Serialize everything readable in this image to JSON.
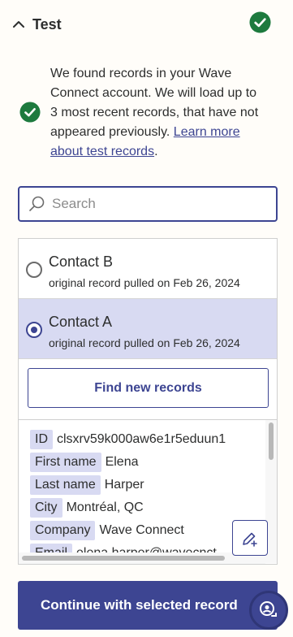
{
  "section": {
    "title": "Test",
    "status_icon": "check-circle-icon",
    "status_color": "#1d7a3e"
  },
  "info": {
    "text": "We found records in your Wave Connect account. We will load up to 3 most recent records, that have not appeared previously. ",
    "link_text": "Learn more about test records",
    "trailing": "."
  },
  "search": {
    "value": "",
    "placeholder": "Search"
  },
  "records": [
    {
      "title": "Contact B",
      "subtitle": "original record pulled on Feb 26, 2024",
      "selected": false
    },
    {
      "title": "Contact A",
      "subtitle": "original record pulled on Feb 26, 2024",
      "selected": true
    }
  ],
  "find_button_label": "Find new records",
  "details": [
    {
      "key": "ID",
      "value": "clsxrv59k000aw6e1r5eduun1"
    },
    {
      "key": "First name",
      "value": "Elena"
    },
    {
      "key": "Last name",
      "value": "Harper"
    },
    {
      "key": "City",
      "value": "Montréal, QC"
    },
    {
      "key": "Company",
      "value": "Wave Connect"
    },
    {
      "key": "Email",
      "value": "elena.harper@wavecnct"
    }
  ],
  "continue_button_label": "Continue with selected record",
  "colors": {
    "accent": "#3d4592",
    "selected_row": "#d8daf2",
    "success": "#1d7a3e"
  }
}
